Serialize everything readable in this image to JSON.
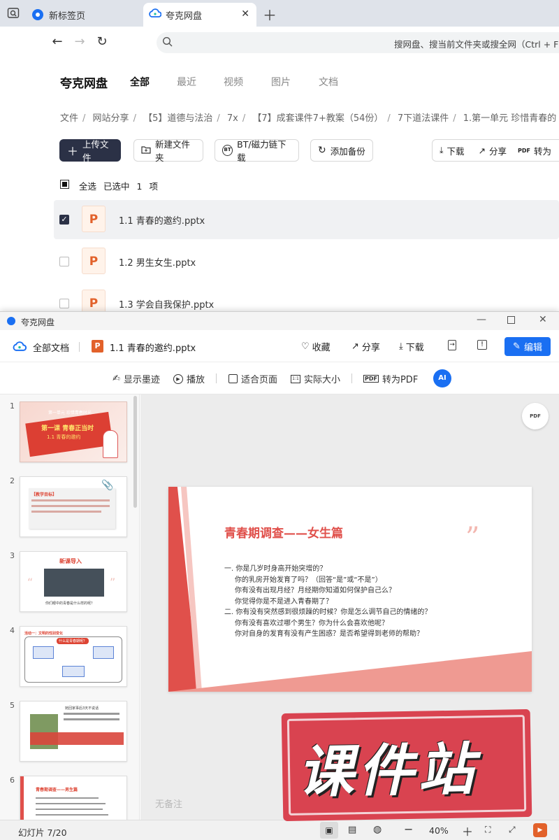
{
  "browser": {
    "tabs": [
      {
        "label": "新标签页"
      },
      {
        "label": "夸克网盘"
      }
    ],
    "address_placeholder": "搜网盘、搜当前文件夹或搜全网（Ctrl + F"
  },
  "app": {
    "logo": "夸克网盘",
    "menu": [
      "全部",
      "最近",
      "视频",
      "图片",
      "文档"
    ],
    "breadcrumb": [
      "文件",
      "网站分享",
      "【5】道德与法治",
      "7x",
      "【7】成套课件7+教案（54份）",
      "7下道法课件",
      "1.第一单元 珍惜青春的"
    ],
    "toolbar": {
      "upload": "上传文件",
      "new_folder": "新建文件夹",
      "bt": "BT/磁力链下载",
      "backup": "添加备份",
      "download": "下载",
      "share": "分享",
      "to": "转为"
    },
    "selection": {
      "select_all": "全选",
      "selected_prefix": "已选中",
      "count": "1",
      "unit": "项"
    },
    "files": [
      {
        "name": "1.1 青春的邀约.pptx",
        "checked": true
      },
      {
        "name": "1.2 男生女生.pptx",
        "checked": false
      },
      {
        "name": "1.3 学会自我保护.pptx",
        "checked": false
      }
    ]
  },
  "viewer": {
    "window_title": "夸克网盘",
    "all_docs": "全部文档",
    "file_name": "1.1 青春的邀约.pptx",
    "actions": {
      "favorite": "收藏",
      "share": "分享",
      "download": "下载",
      "edit": "编辑"
    },
    "tools": {
      "ink": "显示墨迹",
      "play": "播放",
      "fit": "适合页面",
      "actual": "实际大小",
      "pdf": "转为PDF"
    },
    "thumbs": [
      {
        "num": "1",
        "title": "第一课 青春正当时",
        "subtitle": "1.1 青春的邀约",
        "header": "第一单元 珍惜青春时光"
      },
      {
        "num": "2",
        "title": "【教学目标】"
      },
      {
        "num": "3",
        "title": "新课导入",
        "caption": "你们眼中的青春是什么样的呢？"
      },
      {
        "num": "4",
        "title": "活动一：文明的性别变化",
        "center": "什么是青春期呢？"
      },
      {
        "num": "5",
        "title": "她回家事后3天不说话"
      },
      {
        "num": "6",
        "title": "青春期调查——男生篇"
      }
    ],
    "slide": {
      "title": "青春期调查——女生篇",
      "lines": [
        "一. 你是几岁时身高开始突增的？",
        "你的乳房开始发育了吗？（回答“是”或“不是”）",
        "你有没有出现月经？月经期你知道如何保护自己么？",
        "你觉得你是不是进入青春期了？",
        "二. 你有没有突然感到很烦躁的时候？你是怎么调节自己的情绪的？",
        "你有没有喜欢过哪个男生？你为什么会喜欢他呢？",
        "你对自身的发育有没有产生困惑？是否希望得到老师的帮助？"
      ]
    },
    "no_notes": "无备注",
    "status": {
      "slide_counter": "幻灯片 7/20",
      "zoom": "40%"
    }
  },
  "watermark": "课件站",
  "colors": {
    "accent": "#1a6ff2",
    "dark": "#2b3146",
    "slide_red": "#e0504b"
  }
}
